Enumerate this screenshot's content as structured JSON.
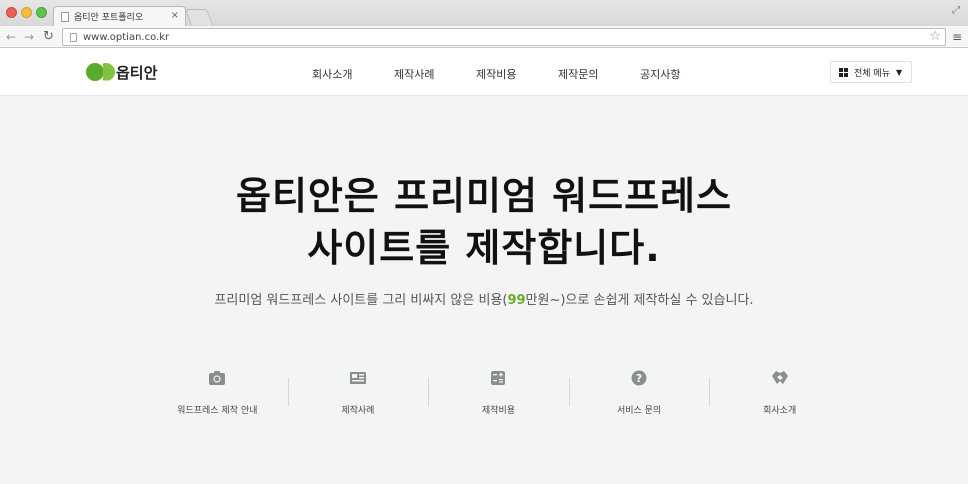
{
  "browser": {
    "tab_title": "옵티안 포트폴리오",
    "tab_close": "×",
    "url": "www.optian.co.kr"
  },
  "header": {
    "logo_text": "옵티안",
    "nav": [
      "회사소개",
      "제작사례",
      "제작비용",
      "제작문의",
      "공지사항"
    ],
    "all_menu_label": "전체 메뉴"
  },
  "hero": {
    "title_line1": "옵티안은 프리미엄 워드프레스",
    "title_line2": "사이트를 제작합니다.",
    "subtitle_before": "프리미엄 워드프레스 사이트를 그리 비싸지 않은 비용(",
    "subtitle_price": "99",
    "subtitle_after": "만원~)으로 손쉽게 제작하실 수 있습니다."
  },
  "quick_links": [
    {
      "label": "워드프레스 제작 안내",
      "icon": "wordpress-icon"
    },
    {
      "label": "제작사례",
      "icon": "portfolio-icon"
    },
    {
      "label": "제작비용",
      "icon": "calculator-icon"
    },
    {
      "label": "서비스 문의",
      "icon": "question-icon"
    },
    {
      "label": "회사소개",
      "icon": "handshake-icon"
    }
  ],
  "colors": {
    "brand_green": "#5aaa2b",
    "price_green": "#6aad2a",
    "page_bg": "#f3f5f4"
  }
}
